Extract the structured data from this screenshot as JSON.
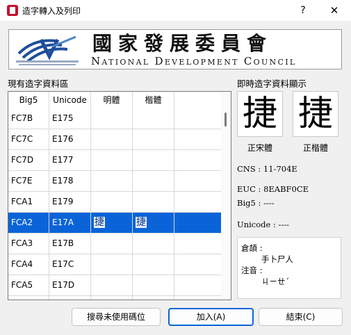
{
  "window": {
    "title": "造字轉入及列印",
    "help_label": "?",
    "close_label": "✕"
  },
  "banner": {
    "chinese_name": "國家發展委員會",
    "english_name": "National Development Council",
    "logo": "ndc-logo-icon"
  },
  "left_panel": {
    "label": "現有造字資料區",
    "columns": [
      "Big5",
      "Unicode",
      "明體",
      "楷體"
    ],
    "rows": [
      {
        "big5": "FC7B",
        "unicode": "E175",
        "ming": "",
        "kai": ""
      },
      {
        "big5": "FC7C",
        "unicode": "E176",
        "ming": "",
        "kai": ""
      },
      {
        "big5": "FC7D",
        "unicode": "E177",
        "ming": "",
        "kai": ""
      },
      {
        "big5": "FC7E",
        "unicode": "E178",
        "ming": "",
        "kai": ""
      },
      {
        "big5": "FCA1",
        "unicode": "E179",
        "ming": "",
        "kai": ""
      },
      {
        "big5": "FCA2",
        "unicode": "E17A",
        "ming": "捷",
        "kai": "捷"
      },
      {
        "big5": "FCA3",
        "unicode": "E17B",
        "ming": "",
        "kai": ""
      },
      {
        "big5": "FCA4",
        "unicode": "E17C",
        "ming": "",
        "kai": ""
      },
      {
        "big5": "FCA5",
        "unicode": "E17D",
        "ming": "",
        "kai": ""
      },
      {
        "big5": "",
        "unicode": "",
        "ming": "",
        "kai": ""
      }
    ],
    "selected_index": 5
  },
  "right_panel": {
    "label": "即時造字資料顯示",
    "preview_glyph": "捷",
    "song_caption": "正宋體",
    "kai_caption": "正楷體",
    "cns": "CNS : 11-704E",
    "euc": "EUC : 8EABF0CE",
    "big5": "Big5 : ----",
    "unicode": "Unicode : ----",
    "cangjie_label": "倉頡 :",
    "cangjie_value": "手卜尸人",
    "zhuyin_label": "注音 :",
    "zhuyin_value": "ㄐㄧㄝˊ"
  },
  "buttons": {
    "search": "搜尋未使用碼位",
    "add": "加入(A)",
    "finish": "結束(C)"
  },
  "colors": {
    "selection": "#0a64d8",
    "primary_border": "#0a64d8",
    "logo_blue": "#1f4e9c"
  }
}
